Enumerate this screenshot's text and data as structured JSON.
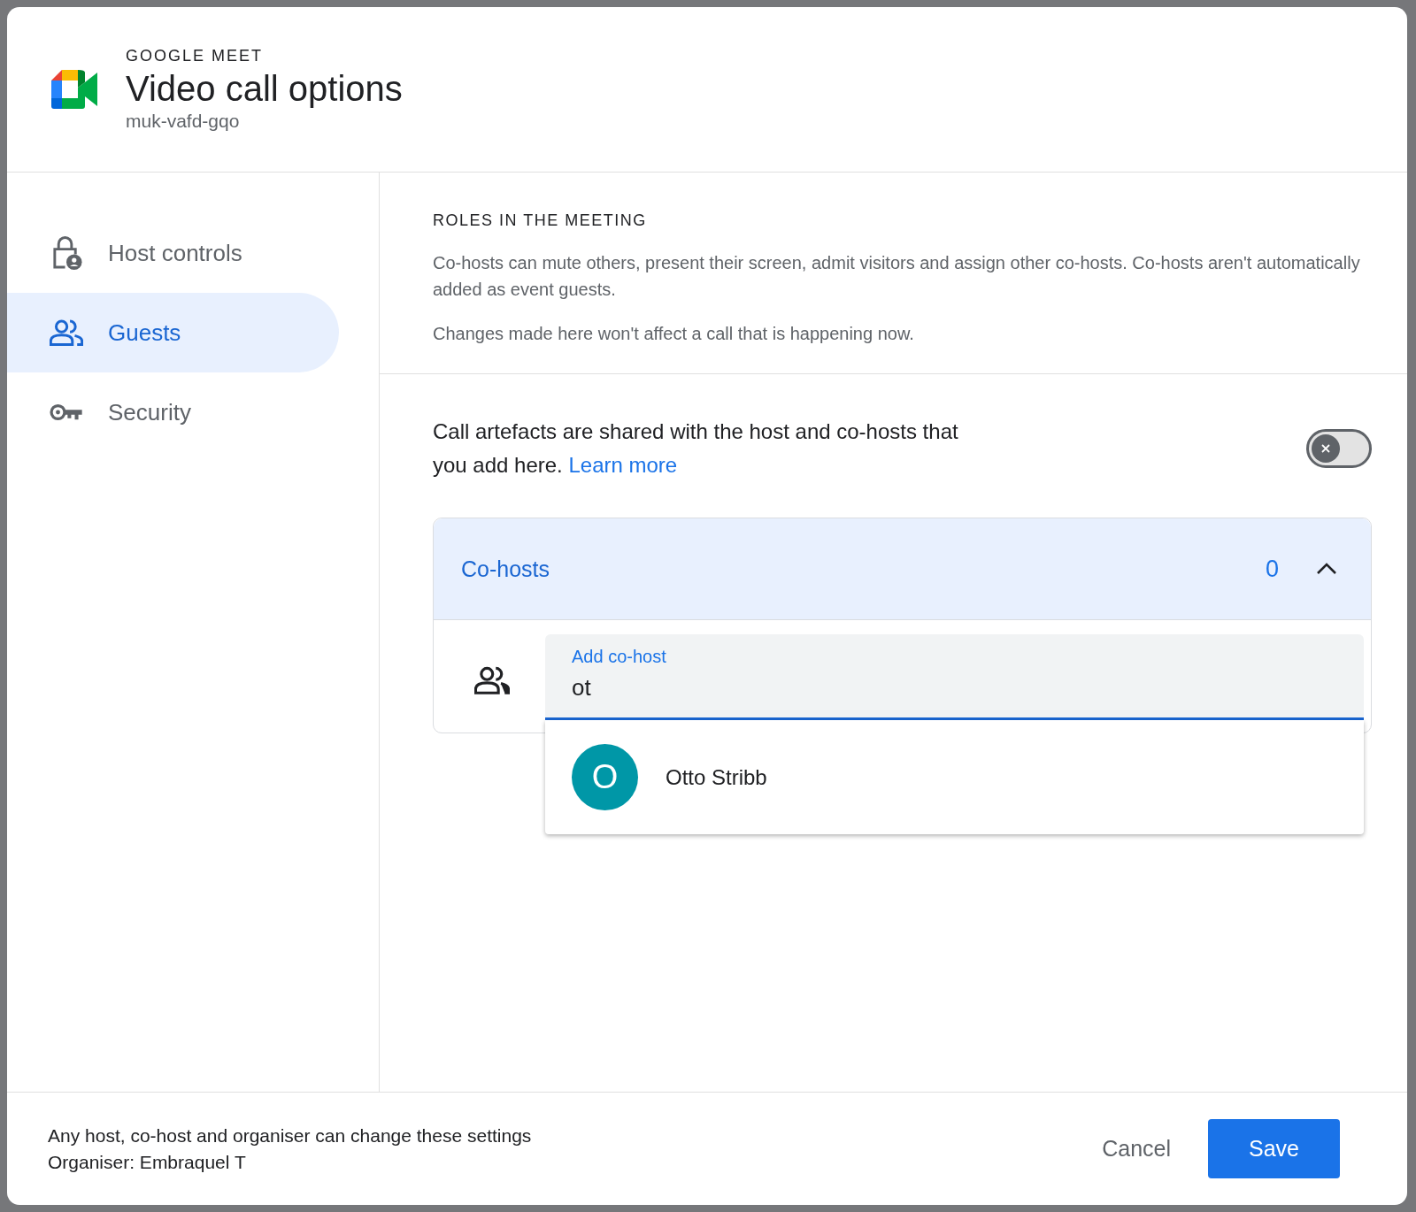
{
  "header": {
    "eyebrow": "GOOGLE MEET",
    "title": "Video call options",
    "meeting_code": "muk-vafd-gqo"
  },
  "sidebar": {
    "items": [
      {
        "label": "Host controls",
        "kind": "lock",
        "selected": false
      },
      {
        "label": "Guests",
        "kind": "people",
        "selected": true
      },
      {
        "label": "Security",
        "kind": "key",
        "selected": false
      }
    ]
  },
  "roles": {
    "heading": "ROLES IN THE MEETING",
    "description": "Co-hosts can mute others, present their screen, admit visitors and assign other co-hosts. Co-hosts aren't automatically added as event guests.",
    "note": "Changes made here won't affect a call that is happening now."
  },
  "artefacts": {
    "text": "Call artefacts are shared with the host and co-hosts that you add here.",
    "link": "Learn more",
    "on": false
  },
  "cohosts": {
    "label": "Co-hosts",
    "count": "0",
    "expanded": true,
    "field": {
      "label": "Add co-host",
      "value": "ot"
    },
    "suggestions": [
      {
        "initial": "O",
        "name": "Otto Stribb",
        "color": "#0097a7"
      }
    ]
  },
  "footer": {
    "lines": [
      "Any host, co-host and organiser can change these settings",
      "Organiser: Embraquel T"
    ],
    "buttons": [
      {
        "label": "Cancel",
        "kind": "text"
      },
      {
        "label": "Save",
        "kind": "filled"
      }
    ]
  }
}
